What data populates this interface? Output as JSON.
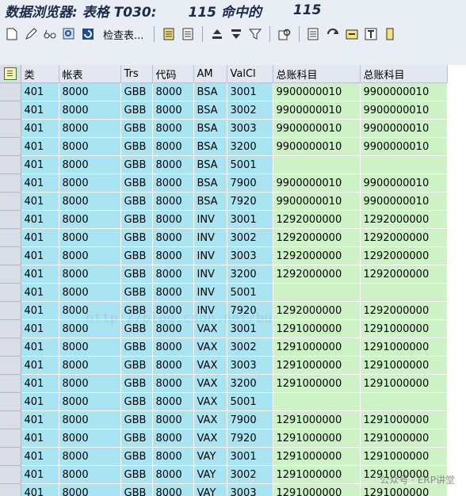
{
  "title": {
    "prefix": "数据浏览器: 表格 T030:",
    "hits": "115 命中的",
    "count": "115"
  },
  "toolbar": {
    "check_table_label": "检查表..."
  },
  "columns": [
    "类",
    "帐表",
    "Trs",
    "代码",
    "AM",
    "ValCl",
    "总账科目",
    "总账科目"
  ],
  "rows": [
    [
      "401",
      "8000",
      "GBB",
      "8000",
      "BSA",
      "3001",
      "9900000010",
      "9900000010"
    ],
    [
      "401",
      "8000",
      "GBB",
      "8000",
      "BSA",
      "3002",
      "9900000010",
      "9900000010"
    ],
    [
      "401",
      "8000",
      "GBB",
      "8000",
      "BSA",
      "3003",
      "9900000010",
      "9900000010"
    ],
    [
      "401",
      "8000",
      "GBB",
      "8000",
      "BSA",
      "3200",
      "9900000010",
      "9900000010"
    ],
    [
      "401",
      "8000",
      "GBB",
      "8000",
      "BSA",
      "5001",
      "",
      ""
    ],
    [
      "401",
      "8000",
      "GBB",
      "8000",
      "BSA",
      "7900",
      "9900000010",
      "9900000010"
    ],
    [
      "401",
      "8000",
      "GBB",
      "8000",
      "BSA",
      "7920",
      "9900000010",
      "9900000010"
    ],
    [
      "401",
      "8000",
      "GBB",
      "8000",
      "INV",
      "3001",
      "1292000000",
      "1292000000"
    ],
    [
      "401",
      "8000",
      "GBB",
      "8000",
      "INV",
      "3002",
      "1292000000",
      "1292000000"
    ],
    [
      "401",
      "8000",
      "GBB",
      "8000",
      "INV",
      "3003",
      "1292000000",
      "1292000000"
    ],
    [
      "401",
      "8000",
      "GBB",
      "8000",
      "INV",
      "3200",
      "1292000000",
      "1292000000"
    ],
    [
      "401",
      "8000",
      "GBB",
      "8000",
      "INV",
      "5001",
      "",
      ""
    ],
    [
      "401",
      "8000",
      "GBB",
      "8000",
      "INV",
      "7920",
      "1292000000",
      "1292000000"
    ],
    [
      "401",
      "8000",
      "GBB",
      "8000",
      "VAX",
      "3001",
      "1291000000",
      "1291000000"
    ],
    [
      "401",
      "8000",
      "GBB",
      "8000",
      "VAX",
      "3002",
      "1291000000",
      "1291000000"
    ],
    [
      "401",
      "8000",
      "GBB",
      "8000",
      "VAX",
      "3003",
      "1291000000",
      "1291000000"
    ],
    [
      "401",
      "8000",
      "GBB",
      "8000",
      "VAX",
      "3200",
      "1291000000",
      "1291000000"
    ],
    [
      "401",
      "8000",
      "GBB",
      "8000",
      "VAX",
      "5001",
      "",
      ""
    ],
    [
      "401",
      "8000",
      "GBB",
      "8000",
      "VAX",
      "7900",
      "1291000000",
      "1291000000"
    ],
    [
      "401",
      "8000",
      "GBB",
      "8000",
      "VAX",
      "7920",
      "1291000000",
      "1291000000"
    ],
    [
      "401",
      "8000",
      "GBB",
      "8000",
      "VAY",
      "3001",
      "1291000000",
      "1291000000"
    ],
    [
      "401",
      "8000",
      "GBB",
      "8000",
      "VAY",
      "3002",
      "1291000000",
      "1291000000"
    ],
    [
      "401",
      "8000",
      "GBB",
      "8000",
      "VAY",
      "3003",
      "1291000000",
      "1291000000"
    ]
  ],
  "watermark": "http://blog.csdn.net/bu",
  "wechat_mark": "公众号 · ERP讲堂",
  "colors": {
    "key_cells": "#a8e4f2",
    "value_cells": "#ccf2c6",
    "background": "#e9eef5"
  }
}
